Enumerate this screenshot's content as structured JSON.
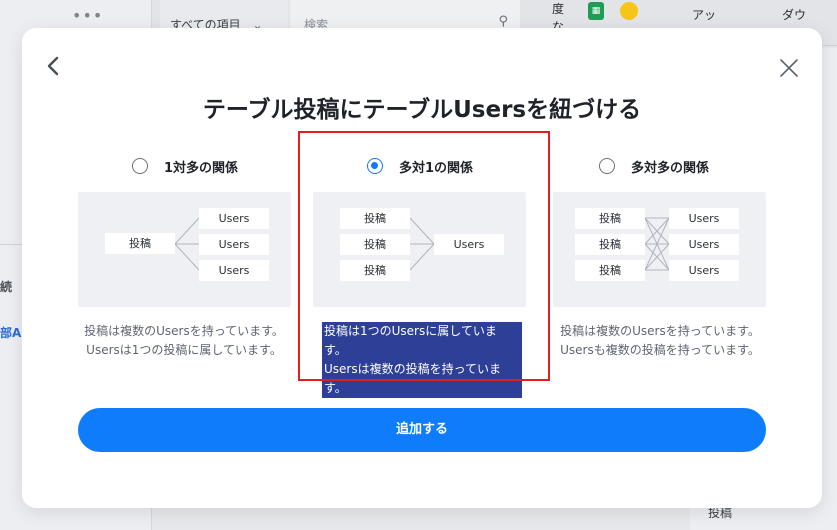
{
  "background": {
    "filter_label": "すべての項目",
    "search_placeholder": "検索",
    "toolbar_ja": "度な",
    "app_label": "アッ",
    "download_label": "ダウ",
    "left_label_1": "続",
    "left_label_2": "部AI",
    "bottom_text": "投稿"
  },
  "modal": {
    "title": "テーブル投稿にテーブルUsersを紐づける",
    "add_button_label": "追加する",
    "options": [
      {
        "label": "1対多の関係",
        "selected": false,
        "desc_line1": "投稿は複数のUsersを持っています。",
        "desc_line2": "Usersは1つの投稿に属しています。",
        "left_boxes": [
          "投稿"
        ],
        "right_boxes": [
          "Users",
          "Users",
          "Users"
        ]
      },
      {
        "label": "多対1の関係",
        "selected": true,
        "desc_line1": "投稿は1つのUsersに属しています。",
        "desc_line2": "Usersは複数の投稿を持っています。",
        "left_boxes": [
          "投稿",
          "投稿",
          "投稿"
        ],
        "right_boxes": [
          "Users"
        ]
      },
      {
        "label": "多対多の関係",
        "selected": false,
        "desc_line1": "投稿は複数のUsersを持っています。",
        "desc_line2": "Usersも複数の投稿を持っています。",
        "left_boxes": [
          "投稿",
          "投稿",
          "投稿"
        ],
        "right_boxes": [
          "Users",
          "Users",
          "Users"
        ]
      }
    ]
  },
  "colors": {
    "accent": "#1677ff",
    "button": "#0f7dfb",
    "selection_highlight": "#2d3f97",
    "annotation_border": "#e02020"
  }
}
